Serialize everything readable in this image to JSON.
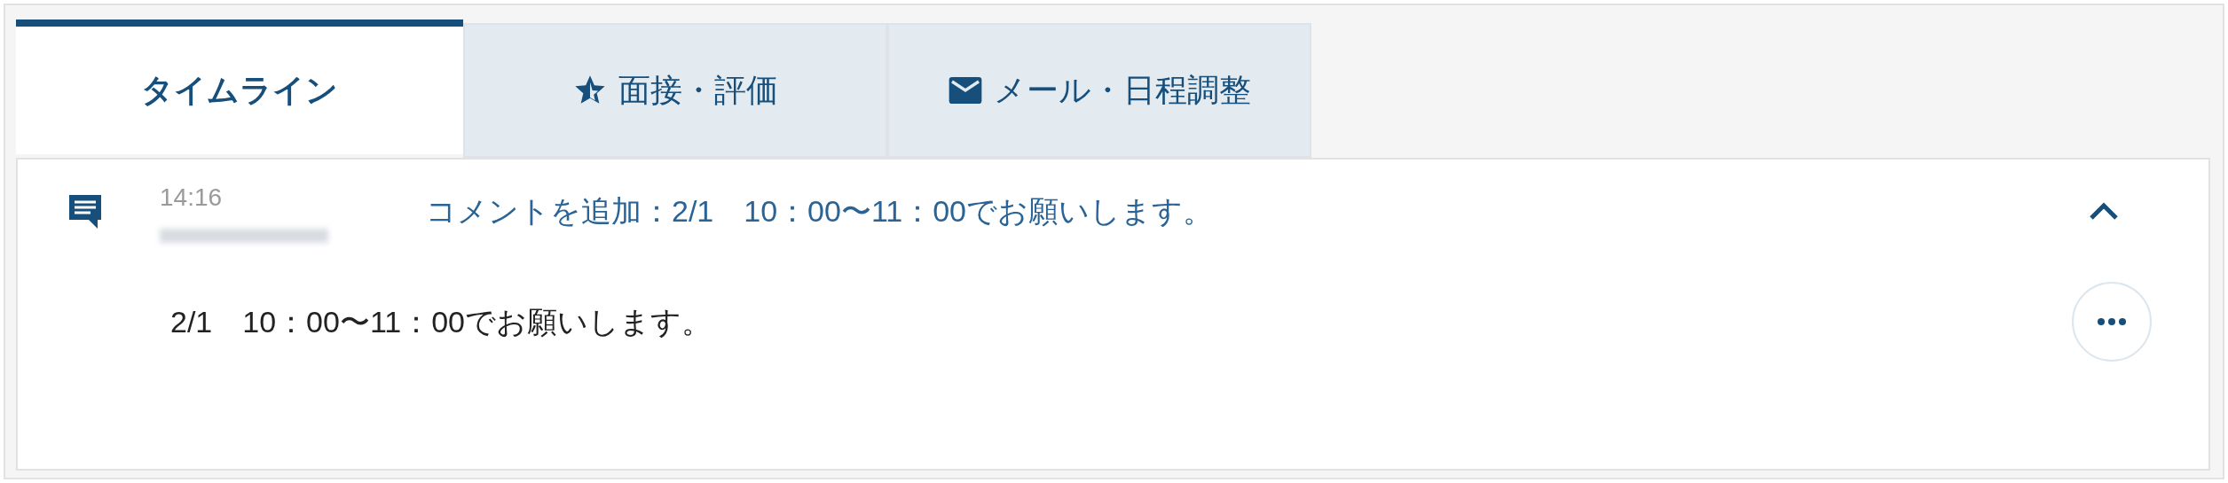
{
  "tabs": [
    {
      "label": "タイムライン",
      "kind": "plain",
      "selected": true
    },
    {
      "label": "面接・評価",
      "kind": "rating",
      "selected": false
    },
    {
      "label": "メール・日程調整",
      "kind": "mail",
      "selected": false
    }
  ],
  "timeline": [
    {
      "time": "14:16",
      "title": "コメントを追加：2/1　10：00〜11：00でお願いします。",
      "expanded": true,
      "body": "2/1　10：00〜11：00でお願いします。"
    }
  ]
}
